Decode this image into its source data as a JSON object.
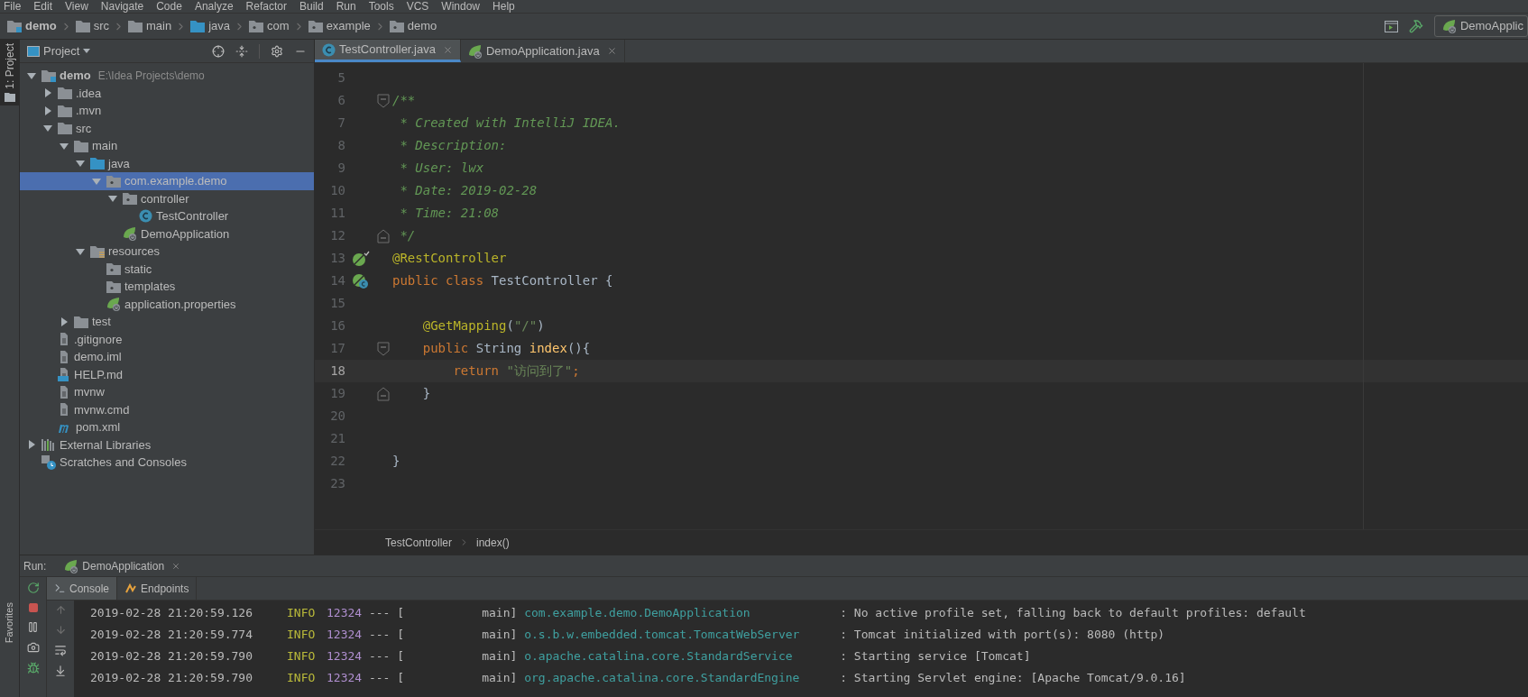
{
  "menu": [
    "File",
    "Edit",
    "View",
    "Navigate",
    "Code",
    "Analyze",
    "Refactor",
    "Build",
    "Run",
    "Tools",
    "VCS",
    "Window",
    "Help"
  ],
  "breadcrumbs": [
    {
      "label": "demo",
      "kind": "module"
    },
    {
      "label": "src",
      "kind": "folder"
    },
    {
      "label": "main",
      "kind": "folder"
    },
    {
      "label": "java",
      "kind": "source"
    },
    {
      "label": "com",
      "kind": "package"
    },
    {
      "label": "example",
      "kind": "package"
    },
    {
      "label": "demo",
      "kind": "package"
    }
  ],
  "run_config": "DemoApplic",
  "side_tabs": {
    "top": "1: Project",
    "bottom": "Favorites"
  },
  "project_panel": {
    "title": "Project",
    "tree": [
      {
        "label": "demo",
        "hint": "E:\\Idea Projects\\demo",
        "kind": "module",
        "expanded": true,
        "selected": false,
        "children": [
          {
            "label": ".idea",
            "kind": "folder",
            "expanded": false,
            "selected": false
          },
          {
            "label": ".mvn",
            "kind": "folder",
            "expanded": false,
            "selected": false
          },
          {
            "label": "src",
            "kind": "folder",
            "expanded": true,
            "selected": false,
            "children": [
              {
                "label": "main",
                "kind": "folder",
                "expanded": true,
                "selected": false,
                "children": [
                  {
                    "label": "java",
                    "kind": "source",
                    "expanded": true,
                    "selected": false,
                    "children": [
                      {
                        "label": "com.example.demo",
                        "kind": "package",
                        "expanded": true,
                        "selected": true,
                        "children": [
                          {
                            "label": "controller",
                            "kind": "package",
                            "expanded": true,
                            "selected": false,
                            "children": [
                              {
                                "label": "TestController",
                                "kind": "class",
                                "selected": false
                              }
                            ]
                          },
                          {
                            "label": "DemoApplication",
                            "kind": "spring",
                            "selected": false
                          }
                        ]
                      }
                    ]
                  },
                  {
                    "label": "resources",
                    "kind": "resources",
                    "expanded": true,
                    "selected": false,
                    "children": [
                      {
                        "label": "static",
                        "kind": "package",
                        "selected": false
                      },
                      {
                        "label": "templates",
                        "kind": "package",
                        "selected": false
                      },
                      {
                        "label": "application.properties",
                        "kind": "spring",
                        "selected": false
                      }
                    ]
                  }
                ]
              },
              {
                "label": "test",
                "kind": "folder",
                "expanded": false,
                "selected": false
              }
            ]
          },
          {
            "label": ".gitignore",
            "kind": "file",
            "selected": false
          },
          {
            "label": "demo.iml",
            "kind": "file",
            "selected": false
          },
          {
            "label": "HELP.md",
            "kind": "markdown",
            "selected": false
          },
          {
            "label": "mvnw",
            "kind": "file",
            "selected": false
          },
          {
            "label": "mvnw.cmd",
            "kind": "file",
            "selected": false
          },
          {
            "label": "pom.xml",
            "kind": "maven",
            "selected": false
          }
        ]
      },
      {
        "label": "External Libraries",
        "kind": "libraries",
        "expanded": false,
        "selected": false
      },
      {
        "label": "Scratches and Consoles",
        "kind": "scratches",
        "selected": false
      }
    ]
  },
  "editor_tabs": [
    {
      "label": "TestController.java",
      "kind": "class",
      "selected": true
    },
    {
      "label": "DemoApplication.java",
      "kind": "spring",
      "selected": false
    }
  ],
  "code": [
    {
      "number": "5",
      "current": false
    },
    {
      "number": "6",
      "current": false,
      "fold_open": true,
      "tokens": [
        {
          "kind": "comment",
          "text": "/**"
        }
      ]
    },
    {
      "number": "7",
      "current": false,
      "tokens": [
        {
          "kind": "comment",
          "text": " * Created with IntelliJ IDEA."
        }
      ]
    },
    {
      "number": "8",
      "current": false,
      "tokens": [
        {
          "kind": "comment",
          "text": " * Description:"
        }
      ]
    },
    {
      "number": "9",
      "current": false,
      "tokens": [
        {
          "kind": "comment",
          "text": " * User: lwx"
        }
      ]
    },
    {
      "number": "10",
      "current": false,
      "tokens": [
        {
          "kind": "comment",
          "text": " * Date: 2019-02-28"
        }
      ]
    },
    {
      "number": "11",
      "current": false,
      "tokens": [
        {
          "kind": "comment",
          "text": " * Time: 21:08"
        }
      ]
    },
    {
      "number": "12",
      "current": false,
      "fold_close": true,
      "tokens": [
        {
          "kind": "comment",
          "text": " */"
        }
      ]
    },
    {
      "number": "13",
      "current": false,
      "bean_marker": true,
      "tokens": [
        {
          "kind": "annotation",
          "text": "@RestController"
        }
      ]
    },
    {
      "number": "14",
      "current": false,
      "class_marker": true,
      "tokens": [
        {
          "kind": "keyword",
          "text": "public class "
        },
        {
          "kind": "plain",
          "text": "TestController {"
        }
      ]
    },
    {
      "number": "15",
      "current": false
    },
    {
      "number": "16",
      "current": false,
      "tokens": [
        {
          "kind": "annotation",
          "text": "    @GetMapping"
        },
        {
          "kind": "plain",
          "text": "("
        },
        {
          "kind": "string",
          "text": "\"/\""
        },
        {
          "kind": "plain",
          "text": ")"
        }
      ]
    },
    {
      "number": "17",
      "current": false,
      "fold_open": true,
      "tokens": [
        {
          "kind": "keyword",
          "text": "    public "
        },
        {
          "kind": "plain",
          "text": "String "
        },
        {
          "kind": "method",
          "text": "index"
        },
        {
          "kind": "plain",
          "text": "(){"
        }
      ]
    },
    {
      "number": "18",
      "current": true,
      "tokens": [
        {
          "kind": "keyword",
          "text": "        return "
        },
        {
          "kind": "string",
          "text": "\"访问到了\""
        },
        {
          "kind": "keyword",
          "text": ";"
        }
      ]
    },
    {
      "number": "19",
      "current": false,
      "fold_close": true,
      "tokens": [
        {
          "kind": "plain",
          "text": "    }"
        }
      ]
    },
    {
      "number": "20",
      "current": false
    },
    {
      "number": "21",
      "current": false
    },
    {
      "number": "22",
      "current": false,
      "tokens": [
        {
          "kind": "plain",
          "text": "}"
        }
      ]
    },
    {
      "number": "23",
      "current": false
    }
  ],
  "editor_breadcrumbs": [
    "TestController",
    "index()"
  ],
  "run": {
    "label": "Run:",
    "tab": "DemoApplication"
  },
  "console_tabs": [
    {
      "label": "Console",
      "kind": "console",
      "selected": true
    },
    {
      "label": "Endpoints",
      "kind": "endpoints",
      "selected": false
    }
  ],
  "console_lines": [
    {
      "time": "2019-02-28 21:20:59.126",
      "level": "INFO",
      "pid": "12324",
      "sep": "---",
      "thread": "[           main]",
      "logger": "com.example.demo.DemoApplication",
      "message": ": No active profile set, falling back to default profiles: default"
    },
    {
      "time": "2019-02-28 21:20:59.774",
      "level": "INFO",
      "pid": "12324",
      "sep": "---",
      "thread": "[           main]",
      "logger": "o.s.b.w.embedded.tomcat.TomcatWebServer",
      "message": ": Tomcat initialized with port(s): 8080 (http)"
    },
    {
      "time": "2019-02-28 21:20:59.790",
      "level": "INFO",
      "pid": "12324",
      "sep": "---",
      "thread": "[           main]",
      "logger": "o.apache.catalina.core.StandardService",
      "message": ": Starting service [Tomcat]"
    },
    {
      "time": "2019-02-28 21:20:59.790",
      "level": "INFO",
      "pid": "12324",
      "sep": "---",
      "thread": "[           main]",
      "logger": "org.apache.catalina.core.StandardEngine",
      "message": ": Starting Servlet engine: [Apache Tomcat/9.0.16]"
    }
  ]
}
